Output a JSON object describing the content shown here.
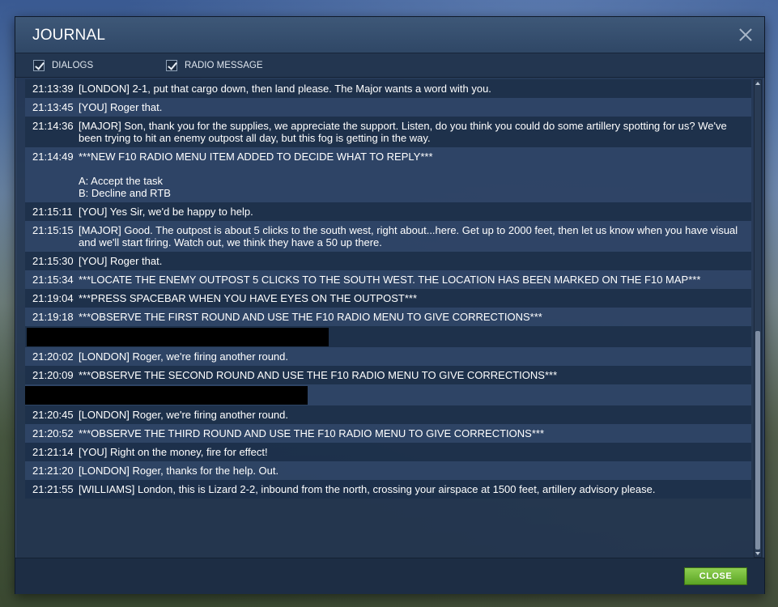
{
  "window": {
    "title": "JOURNAL"
  },
  "filters": [
    {
      "label": "DIALOGS",
      "checked": true
    },
    {
      "label": "RADIO MESSAGE",
      "checked": true
    }
  ],
  "entries": [
    {
      "time": "21:13:39",
      "text": "[LONDON] 2-1, put that cargo down, then land please. The Major wants a word with you."
    },
    {
      "time": "21:13:45",
      "text": "[YOU] Roger that."
    },
    {
      "time": "21:14:36",
      "text": "[MAJOR] Son, thank you for the supplies, we appreciate the support. Listen, do you think you could do some artillery spotting for us? We've been trying to hit an enemy outpost all day, but this fog is getting in the way."
    },
    {
      "time": "21:14:49",
      "text": "***NEW F10 RADIO MENU ITEM ADDED TO DECIDE WHAT TO REPLY***\n\nA: Accept the task\nB: Decline and RTB"
    },
    {
      "time": "21:15:11",
      "text": "[YOU] Yes Sir, we'd be happy to help."
    },
    {
      "time": "21:15:15",
      "text": "[MAJOR] Good. The outpost is about 5 clicks to the south west, right about...here. Get up to 2000 feet, then let us know when you have visual and we'll start firing. Watch out, we think they have a 50 up there."
    },
    {
      "time": "21:15:30",
      "text": "[YOU] Roger that."
    },
    {
      "time": "21:15:34",
      "text": "***LOCATE THE ENEMY OUTPOST 5 CLICKS TO THE SOUTH WEST. THE LOCATION HAS BEEN MARKED ON THE F10 MAP***"
    },
    {
      "time": "21:19:04",
      "text": "***PRESS SPACEBAR WHEN YOU HAVE EYES ON THE OUTPOST***"
    },
    {
      "time": "21:19:18",
      "text": "***OBSERVE THE FIRST ROUND AND USE THE F10 RADIO MENU TO GIVE CORRECTIONS***"
    },
    {
      "redacted": true
    },
    {
      "time": "21:20:02",
      "text": "[LONDON] Roger, we're firing another round."
    },
    {
      "time": "21:20:09",
      "text": "***OBSERVE THE SECOND ROUND AND USE THE F10 RADIO MENU TO GIVE CORRECTIONS***"
    },
    {
      "redacted": true
    },
    {
      "time": "21:20:45",
      "text": "[LONDON] Roger, we're firing another round."
    },
    {
      "time": "21:20:52",
      "text": "***OBSERVE THE THIRD ROUND AND USE THE F10 RADIO MENU TO GIVE CORRECTIONS***"
    },
    {
      "time": "21:21:14",
      "text": "[YOU] Right on the money, fire for effect!"
    },
    {
      "time": "21:21:20",
      "text": "[LONDON] Roger, thanks for the help. Out."
    },
    {
      "time": "21:21:55",
      "text": "[WILLIAMS] London, this is Lizard 2-2, inbound from the north, crossing your airspace at 1500 feet, artillery advisory please."
    }
  ],
  "footer": {
    "close_label": "CLOSE",
    "close_color": "#6cb630"
  }
}
